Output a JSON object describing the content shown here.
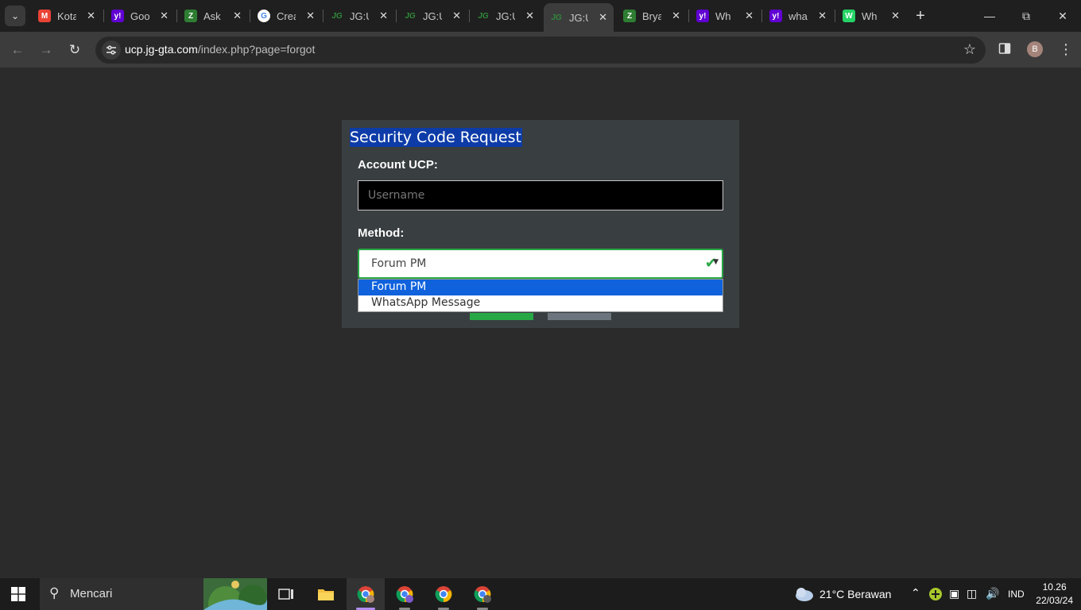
{
  "browser": {
    "tabs": [
      {
        "title": "Kota",
        "icon": "gmail-icon",
        "color": "#ea4335",
        "letter": "M"
      },
      {
        "title": "Goo",
        "icon": "yahoo-icon",
        "color": "#6001d2",
        "letter": "y!"
      },
      {
        "title": "Ask",
        "icon": "brainly-icon",
        "color": "#2e7d32",
        "letter": "Z"
      },
      {
        "title": "Crea",
        "icon": "google-icon",
        "color": "#ffffff",
        "letter": "G"
      },
      {
        "title": "JG:U",
        "icon": "jg-icon",
        "color": "#2f8a3a",
        "letter": "JG"
      },
      {
        "title": "JG:U",
        "icon": "jg-icon",
        "color": "#2f8a3a",
        "letter": "JG"
      },
      {
        "title": "JG:U",
        "icon": "jg-icon",
        "color": "#2f8a3a",
        "letter": "JG"
      },
      {
        "title": "JG:U",
        "icon": "jg-icon",
        "color": "#2f8a3a",
        "letter": "JG",
        "active": true
      },
      {
        "title": "Brya",
        "icon": "brainly-icon",
        "color": "#2e7d32",
        "letter": "Z"
      },
      {
        "title": "Wh",
        "icon": "yahoo-icon",
        "color": "#6001d2",
        "letter": "y!"
      },
      {
        "title": "wha",
        "icon": "yahoo-icon",
        "color": "#6001d2",
        "letter": "y!"
      },
      {
        "title": "Wh",
        "icon": "whatsapp-icon",
        "color": "#25d366",
        "letter": "W"
      }
    ],
    "url_host": "ucp.jg-gta.com",
    "url_path": "/index.php?page=forgot",
    "profile_initial": "B"
  },
  "form": {
    "title": "Security Code Request",
    "account_label": "Account UCP:",
    "username_placeholder": "Username",
    "method_label": "Method:",
    "method_value": "Forum PM",
    "options": [
      "Forum PM",
      "WhatsApp Message"
    ],
    "selected_option": 0,
    "accent_color": "#28a745"
  },
  "taskbar": {
    "search_placeholder": "Mencari",
    "weather": "21°C  Berawan",
    "language": "IND",
    "time": "10.26",
    "date": "22/03/24"
  }
}
